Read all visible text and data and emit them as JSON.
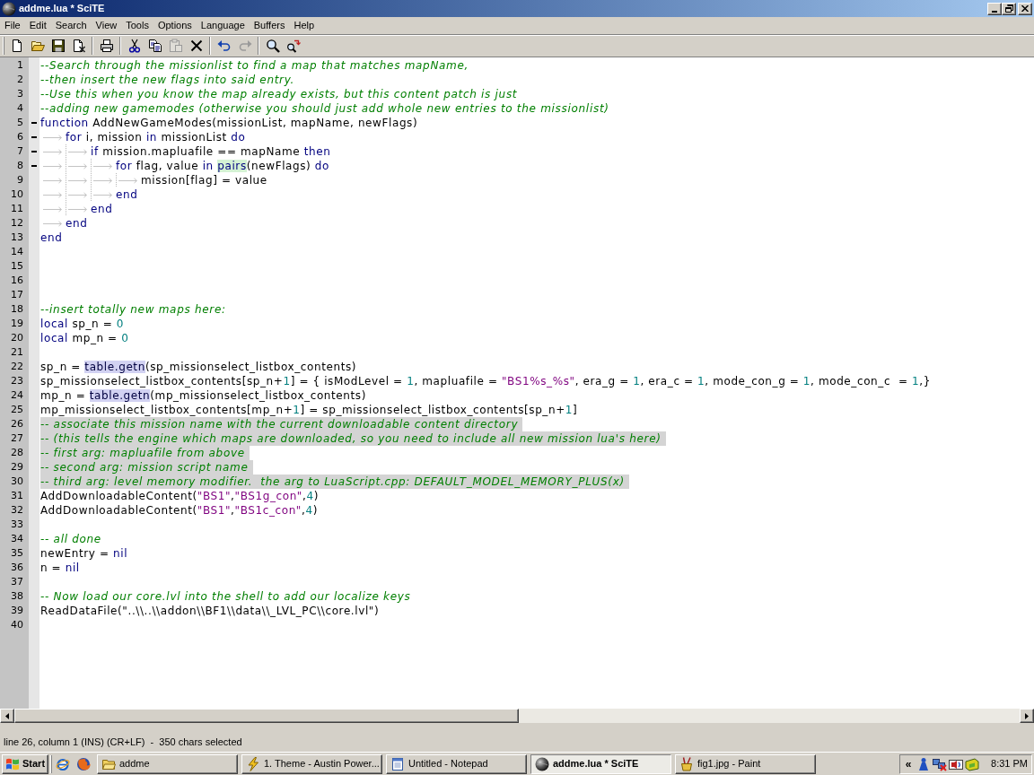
{
  "window": {
    "title": "addme.lua * SciTE"
  },
  "menu": [
    "File",
    "Edit",
    "Search",
    "View",
    "Tools",
    "Options",
    "Language",
    "Buffers",
    "Help"
  ],
  "toolbar": [
    {
      "buttons": [
        {
          "kind": "new",
          "disabled": false
        },
        {
          "kind": "open",
          "disabled": false
        },
        {
          "kind": "save",
          "disabled": false
        },
        {
          "kind": "close",
          "disabled": false
        }
      ]
    },
    {
      "buttons": [
        {
          "kind": "print",
          "disabled": false
        }
      ]
    },
    {
      "buttons": [
        {
          "kind": "cut",
          "disabled": false
        },
        {
          "kind": "copy",
          "disabled": false
        },
        {
          "kind": "paste",
          "disabled": true
        },
        {
          "kind": "delete",
          "disabled": false
        }
      ]
    },
    {
      "buttons": [
        {
          "kind": "undo",
          "disabled": false
        },
        {
          "kind": "redo",
          "disabled": true
        }
      ]
    },
    {
      "buttons": [
        {
          "kind": "find",
          "disabled": false
        },
        {
          "kind": "replace",
          "disabled": false
        }
      ]
    }
  ],
  "editor": {
    "lines": [
      {
        "number": "1",
        "fold": false,
        "selected": false,
        "tokens": [
          {
            "kind": "comment",
            "text": "--Search through the missionlist to find a map that matches mapName,"
          }
        ]
      },
      {
        "number": "2",
        "fold": false,
        "selected": false,
        "tokens": [
          {
            "kind": "comment",
            "text": "--then insert the new flags into said entry."
          }
        ]
      },
      {
        "number": "3",
        "fold": false,
        "selected": false,
        "tokens": [
          {
            "kind": "comment",
            "text": "--Use this when you know the map already exists, but this content patch is just"
          }
        ]
      },
      {
        "number": "4",
        "fold": false,
        "selected": false,
        "tokens": [
          {
            "kind": "comment",
            "text": "--adding new gamemodes (otherwise you should just add whole new entries to the missionlist)"
          }
        ]
      },
      {
        "number": "5",
        "fold": true,
        "selected": false,
        "tokens": [
          {
            "kind": "keyword",
            "text": "function"
          },
          {
            "kind": "plain",
            "text": " AddNewGameModes(missionList, mapName, newFlags)"
          }
        ]
      },
      {
        "number": "6",
        "fold": true,
        "selected": false,
        "tokens": [
          {
            "kind": "tab"
          },
          {
            "kind": "keyword",
            "text": "for"
          },
          {
            "kind": "plain",
            "text": " i, mission "
          },
          {
            "kind": "keyword",
            "text": "in"
          },
          {
            "kind": "plain",
            "text": " missionList "
          },
          {
            "kind": "keyword",
            "text": "do"
          }
        ]
      },
      {
        "number": "7",
        "fold": true,
        "selected": false,
        "tokens": [
          {
            "kind": "tab"
          },
          {
            "kind": "tab"
          },
          {
            "kind": "keyword",
            "text": "if"
          },
          {
            "kind": "plain",
            "text": " mission.mapluafile == mapName "
          },
          {
            "kind": "keyword",
            "text": "then"
          }
        ]
      },
      {
        "number": "8",
        "fold": true,
        "selected": false,
        "tokens": [
          {
            "kind": "tab"
          },
          {
            "kind": "tab"
          },
          {
            "kind": "tab"
          },
          {
            "kind": "keyword",
            "text": "for"
          },
          {
            "kind": "plain",
            "text": " flag, value "
          },
          {
            "kind": "keyword",
            "text": "in "
          },
          {
            "kind": "builtin",
            "text": "pairs"
          },
          {
            "kind": "plain",
            "text": "(newFlags) "
          },
          {
            "kind": "keyword",
            "text": "do"
          }
        ]
      },
      {
        "number": "9",
        "fold": false,
        "selected": false,
        "tokens": [
          {
            "kind": "tab"
          },
          {
            "kind": "tab"
          },
          {
            "kind": "tab"
          },
          {
            "kind": "tab"
          },
          {
            "kind": "plain",
            "text": "mission[flag] = value"
          }
        ]
      },
      {
        "number": "10",
        "fold": false,
        "selected": false,
        "tokens": [
          {
            "kind": "tab"
          },
          {
            "kind": "tab"
          },
          {
            "kind": "tab"
          },
          {
            "kind": "keyword",
            "text": "end"
          }
        ]
      },
      {
        "number": "11",
        "fold": false,
        "selected": false,
        "tokens": [
          {
            "kind": "tab"
          },
          {
            "kind": "tab"
          },
          {
            "kind": "keyword",
            "text": "end"
          }
        ]
      },
      {
        "number": "12",
        "fold": false,
        "selected": false,
        "tokens": [
          {
            "kind": "tab"
          },
          {
            "kind": "keyword",
            "text": "end"
          }
        ]
      },
      {
        "number": "13",
        "fold": false,
        "selected": false,
        "tokens": [
          {
            "kind": "keyword",
            "text": "end"
          }
        ]
      },
      {
        "number": "14",
        "fold": false,
        "selected": false
      },
      {
        "number": "15",
        "fold": false,
        "selected": false
      },
      {
        "number": "16",
        "fold": false,
        "selected": false
      },
      {
        "number": "17",
        "fold": false,
        "selected": false
      },
      {
        "number": "18",
        "fold": false,
        "selected": false,
        "tokens": [
          {
            "kind": "comment",
            "text": "--insert totally new maps here:"
          }
        ]
      },
      {
        "number": "19",
        "fold": false,
        "selected": false,
        "tokens": [
          {
            "kind": "keyword",
            "text": "local"
          },
          {
            "kind": "plain",
            "text": " sp_n = "
          },
          {
            "kind": "number",
            "text": "0"
          }
        ]
      },
      {
        "number": "20",
        "fold": false,
        "selected": false,
        "tokens": [
          {
            "kind": "keyword",
            "text": "local"
          },
          {
            "kind": "plain",
            "text": " mp_n = "
          },
          {
            "kind": "number",
            "text": "0"
          }
        ]
      },
      {
        "number": "21",
        "fold": false,
        "selected": false
      },
      {
        "number": "22",
        "fold": false,
        "selected": false,
        "tokens": [
          {
            "kind": "plain",
            "text": "sp_n = "
          },
          {
            "kind": "library",
            "text": "table.getn"
          },
          {
            "kind": "plain",
            "text": "(sp_missionselect_listbox_contents)"
          }
        ]
      },
      {
        "number": "23",
        "fold": false,
        "selected": false,
        "tokens": [
          {
            "kind": "plain",
            "text": "sp_missionselect_listbox_contents[sp_n+"
          },
          {
            "kind": "number",
            "text": "1"
          },
          {
            "kind": "plain",
            "text": "] = { isModLevel = "
          },
          {
            "kind": "number",
            "text": "1"
          },
          {
            "kind": "plain",
            "text": ", mapluafile = "
          },
          {
            "kind": "string",
            "text": "\"BS1%s_%s\""
          },
          {
            "kind": "plain",
            "text": ", era_g = "
          },
          {
            "kind": "number",
            "text": "1"
          },
          {
            "kind": "plain",
            "text": ", era_c = "
          },
          {
            "kind": "number",
            "text": "1"
          },
          {
            "kind": "plain",
            "text": ", mode_con_g = "
          },
          {
            "kind": "number",
            "text": "1"
          },
          {
            "kind": "plain",
            "text": ", mode_con_c  = "
          },
          {
            "kind": "number",
            "text": "1"
          },
          {
            "kind": "plain",
            "text": ",}"
          }
        ]
      },
      {
        "number": "24",
        "fold": false,
        "selected": false,
        "tokens": [
          {
            "kind": "plain",
            "text": "mp_n = "
          },
          {
            "kind": "library",
            "text": "table.getn"
          },
          {
            "kind": "plain",
            "text": "(mp_missionselect_listbox_contents)"
          }
        ]
      },
      {
        "number": "25",
        "fold": false,
        "selected": false,
        "tokens": [
          {
            "kind": "plain",
            "text": "mp_missionselect_listbox_contents[mp_n+"
          },
          {
            "kind": "number",
            "text": "1"
          },
          {
            "kind": "plain",
            "text": "] = sp_missionselect_listbox_contents[sp_n+"
          },
          {
            "kind": "number",
            "text": "1"
          },
          {
            "kind": "plain",
            "text": "]"
          }
        ]
      },
      {
        "number": "26",
        "fold": false,
        "selected": true,
        "tokens": [
          {
            "kind": "comment",
            "text": "-- associate this mission name with the current downloadable content directory"
          }
        ]
      },
      {
        "number": "27",
        "fold": false,
        "selected": true,
        "tokens": [
          {
            "kind": "comment",
            "text": "-- (this tells the engine which maps are downloaded, so you need to include all new mission lua's here)"
          }
        ]
      },
      {
        "number": "28",
        "fold": false,
        "selected": true,
        "tokens": [
          {
            "kind": "comment",
            "text": "-- first arg: mapluafile from above"
          }
        ]
      },
      {
        "number": "29",
        "fold": false,
        "selected": true,
        "tokens": [
          {
            "kind": "comment",
            "text": "-- second arg: mission script name"
          }
        ]
      },
      {
        "number": "30",
        "fold": false,
        "selected": true,
        "tokens": [
          {
            "kind": "comment",
            "text": "-- third arg: level memory modifier.  the arg to LuaScript.cpp: DEFAULT_MODEL_MEMORY_PLUS(x)"
          }
        ]
      },
      {
        "number": "31",
        "fold": false,
        "selected": false,
        "tokens": [
          {
            "kind": "plain",
            "text": "AddDownloadableContent("
          },
          {
            "kind": "string",
            "text": "\"BS1\""
          },
          {
            "kind": "plain",
            "text": ","
          },
          {
            "kind": "string",
            "text": "\"BS1g_con\""
          },
          {
            "kind": "plain",
            "text": ","
          },
          {
            "kind": "number",
            "text": "4"
          },
          {
            "kind": "plain",
            "text": ")"
          }
        ]
      },
      {
        "number": "32",
        "fold": false,
        "selected": false,
        "tokens": [
          {
            "kind": "plain",
            "text": "AddDownloadableContent("
          },
          {
            "kind": "string",
            "text": "\"BS1\""
          },
          {
            "kind": "plain",
            "text": ","
          },
          {
            "kind": "string",
            "text": "\"BS1c_con\""
          },
          {
            "kind": "plain",
            "text": ","
          },
          {
            "kind": "number",
            "text": "4"
          },
          {
            "kind": "plain",
            "text": ")"
          }
        ]
      },
      {
        "number": "33",
        "fold": false,
        "selected": false
      },
      {
        "number": "34",
        "fold": false,
        "selected": false,
        "tokens": [
          {
            "kind": "comment",
            "text": "-- all done"
          }
        ]
      },
      {
        "number": "35",
        "fold": false,
        "selected": false,
        "tokens": [
          {
            "kind": "plain",
            "text": "newEntry = "
          },
          {
            "kind": "keyword",
            "text": "nil"
          }
        ]
      },
      {
        "number": "36",
        "fold": false,
        "selected": false,
        "tokens": [
          {
            "kind": "plain",
            "text": "n = "
          },
          {
            "kind": "keyword",
            "text": "nil"
          }
        ]
      },
      {
        "number": "37",
        "fold": false,
        "selected": false
      },
      {
        "number": "38",
        "fold": false,
        "selected": false,
        "tokens": [
          {
            "kind": "comment",
            "text": "-- Now load our core.lvl into the shell to add our localize keys"
          }
        ]
      },
      {
        "number": "39",
        "fold": false,
        "selected": false,
        "tokens": [
          {
            "kind": "plain",
            "text": "ReadDataFile(\"..\\\\..\\\\addon\\\\BF1\\\\data\\\\_LVL_PC\\\\core.lvl\")"
          }
        ]
      },
      {
        "number": "40",
        "fold": false,
        "selected": false
      }
    ]
  },
  "status_bar": {
    "text": "line 26, column 1 (INS) (CR+LF)  -  350 chars selected"
  },
  "taskbar": {
    "start": "Start",
    "tasks": [
      {
        "kind": "folder",
        "label": "addme",
        "selected": false
      },
      {
        "kind": "player",
        "label": "1. Theme - Austin Power...",
        "selected": false
      },
      {
        "kind": "notepad",
        "label": "Untitled - Notepad",
        "selected": false
      },
      {
        "kind": "editor",
        "label": "addme.lua * SciTE",
        "selected": true
      },
      {
        "kind": "paint",
        "label": "fig1.jpg - Paint",
        "selected": false
      }
    ],
    "tray": {
      "chevron": "«",
      "clock": "8:31 PM"
    }
  }
}
